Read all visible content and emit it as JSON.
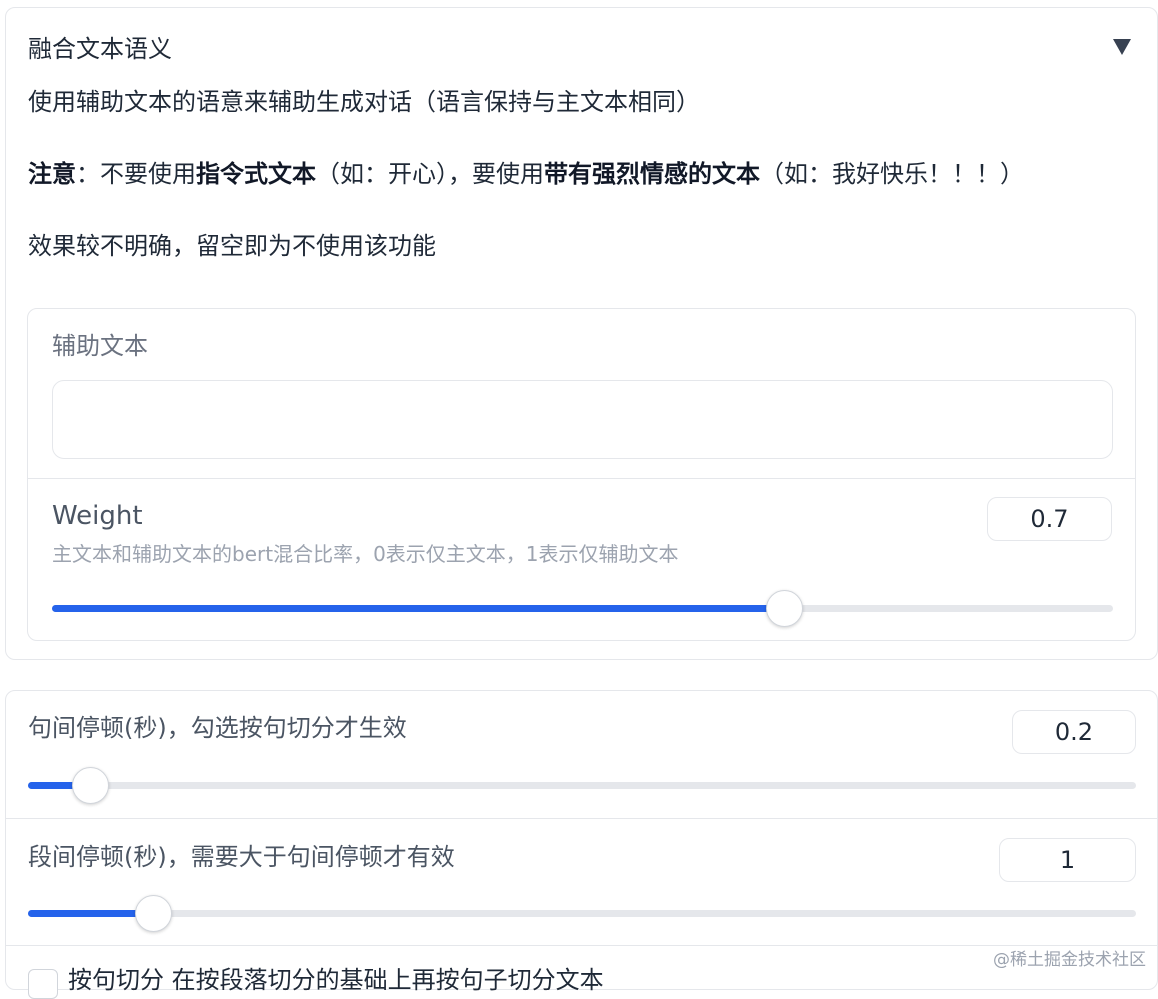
{
  "accordion": {
    "title": "融合文本语义",
    "description": "使用辅助文本的语意来辅助生成对话（语言保持与主文本相同）",
    "note": {
      "prefix_bold": "注意",
      "part1": "：不要使用",
      "bold1": "指令式文本",
      "part2": "（如：开心），要使用",
      "bold2": "带有强烈情感的文本",
      "part3": "（如：我好快乐！！！）"
    },
    "effect_note": "效果较不明确，留空即为不使用该功能",
    "aux_text": {
      "label": "辅助文本",
      "value": ""
    },
    "weight": {
      "label": "Weight",
      "info": "主文本和辅助文本的bert混合比率，0表示仅主文本，1表示仅辅助文本",
      "value": "0.7",
      "level": 0.69
    }
  },
  "pauses": {
    "sentence": {
      "label": "句间停顿(秒)，勾选按句切分才生效",
      "value": "0.2",
      "level": 0.056
    },
    "paragraph": {
      "label": "段间停顿(秒)，需要大于句间停顿才有效",
      "value": "1",
      "level": 0.113
    },
    "split_checkbox_label": "按句切分 在按段落切分的基础上再按句子切分文本"
  },
  "watermark": "@稀土掘金技术社区",
  "colors": {
    "accent": "#2563eb",
    "border": "#e5e7eb",
    "muted_text": "#9ca3af"
  },
  "icons": {
    "collapse": "triangle-down-icon"
  }
}
